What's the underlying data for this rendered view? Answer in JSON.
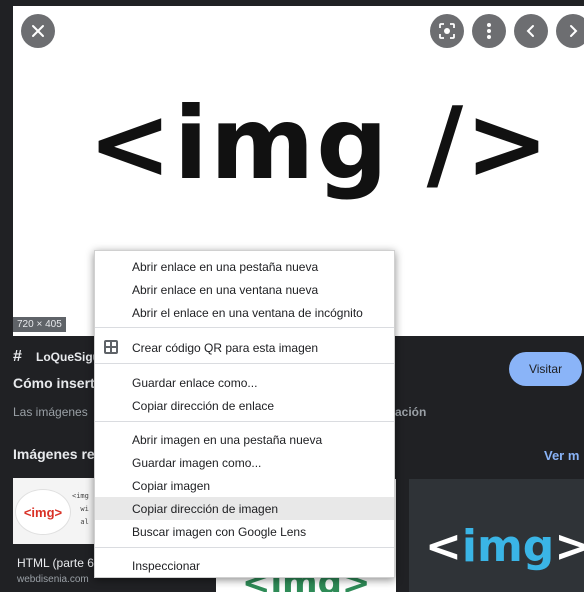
{
  "viewer": {
    "image_text": "<img />",
    "dimensions": "720 × 405"
  },
  "icons": {
    "close": "close-icon",
    "lens": "lens-icon",
    "more": "more-vert-icon",
    "prev": "chevron-left-icon",
    "next": "chevron-right-icon"
  },
  "result": {
    "source_name": "LoQueSigue",
    "title": "Cómo insert",
    "subtitle_left": "Las imágenes",
    "subtitle_right": "ación",
    "visit_label": "Visitar"
  },
  "related": {
    "heading": "Imágenes re",
    "see_more": "Ver m",
    "thumb1": {
      "tag": "<img>",
      "code": "<img\n  wi\n  al",
      "title": "HTML (parte 6",
      "source": "webdisenia.com"
    },
    "thumb2": {
      "text": "<img>"
    },
    "thumb3": {
      "text_open": "<",
      "text_name": "img",
      "text_close": ">"
    }
  },
  "context_menu": {
    "items": [
      "Abrir enlace en una pestaña nueva",
      "Abrir enlace en una ventana nueva",
      "Abrir el enlace en una ventana de incógnito",
      "Crear código QR para esta imagen",
      "Guardar enlace como...",
      "Copiar dirección de enlace",
      "Abrir imagen en una pestaña nueva",
      "Guardar imagen como...",
      "Copiar imagen",
      "Copiar dirección de imagen",
      "Buscar imagen con Google Lens",
      "Inspeccionar"
    ],
    "highlighted": "Copiar dirección de imagen"
  },
  "colors": {
    "background": "#202124",
    "accent": "#8ab4f8",
    "menu_bg": "#ffffff"
  }
}
